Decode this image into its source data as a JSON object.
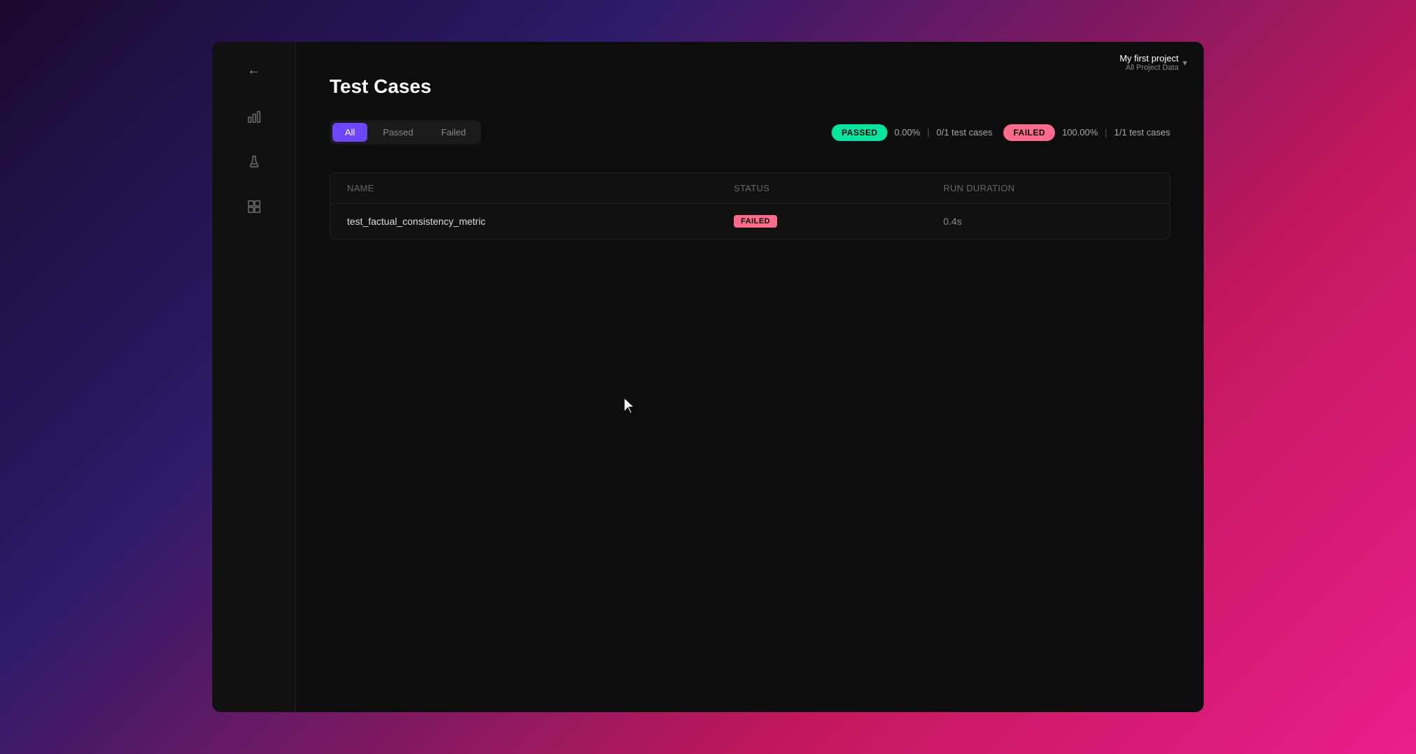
{
  "app": {
    "title": "Test Cases"
  },
  "header": {
    "project_name": "My first project",
    "project_sub": "All Project Data",
    "chevron": "▾"
  },
  "filters": {
    "tabs": [
      {
        "id": "all",
        "label": "All",
        "active": true
      },
      {
        "id": "passed",
        "label": "Passed",
        "active": false
      },
      {
        "id": "failed",
        "label": "Failed",
        "active": false
      }
    ]
  },
  "stats": {
    "passed": {
      "badge": "PASSED",
      "percentage": "0.00%",
      "separator": "|",
      "count_label": "0/1 test cases"
    },
    "failed": {
      "badge": "FAILED",
      "percentage": "100.00%",
      "separator": "|",
      "count_label": "1/1 test cases"
    }
  },
  "table": {
    "headers": {
      "name": "Name",
      "status": "Status",
      "run_duration": "Run Duration"
    },
    "rows": [
      {
        "name": "test_factual_consistency_metric",
        "status": "FAILED",
        "status_type": "failed",
        "run_duration": "0.4s"
      }
    ]
  },
  "nav": {
    "back_label": "←",
    "items": [
      {
        "id": "analytics",
        "icon": "bar-chart-icon"
      },
      {
        "id": "experiments",
        "icon": "flask-icon"
      },
      {
        "id": "reports",
        "icon": "report-icon"
      }
    ]
  }
}
